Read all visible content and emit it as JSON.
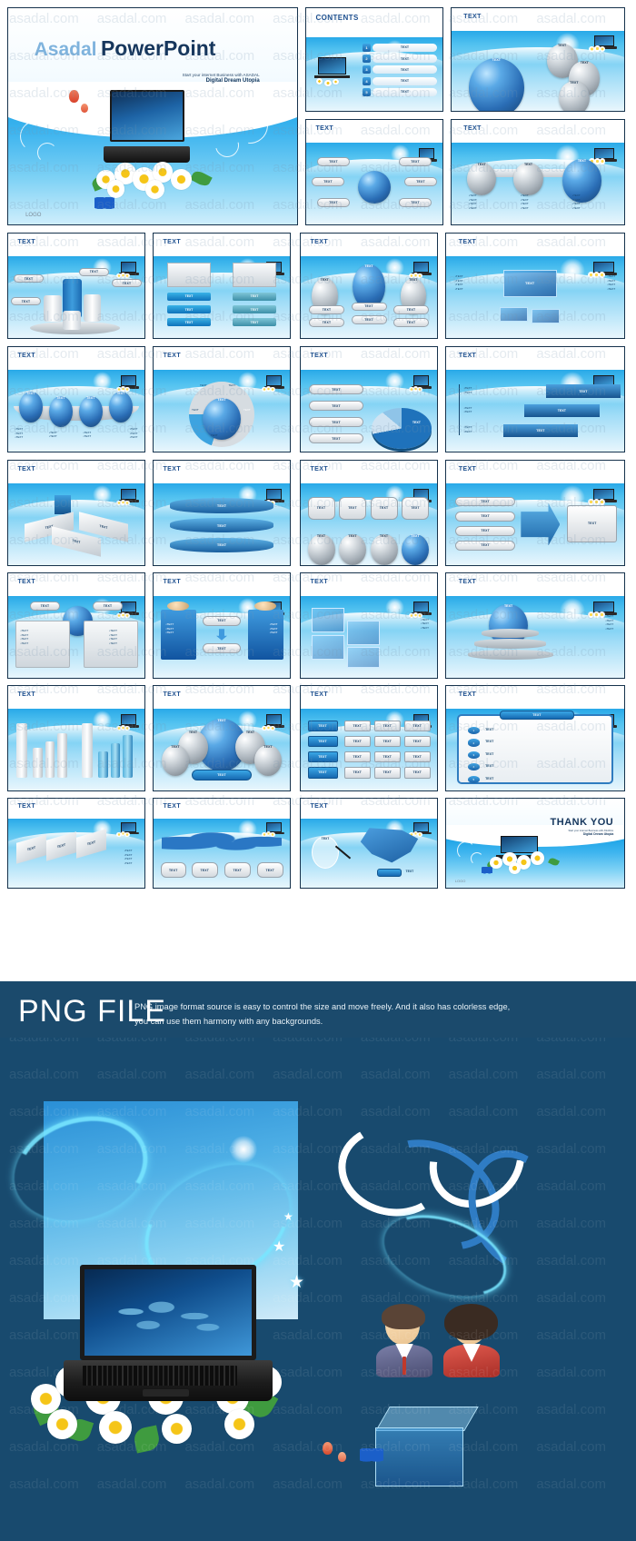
{
  "meta": {
    "watermark_text": "asadal.com"
  },
  "hero": {
    "brand": "Asadal",
    "product": "PowerPoint",
    "tagline": "Start your internet Business with ASADAL",
    "subtitle": "Digital Dream Utopia",
    "logo": "LOGO"
  },
  "contents_slide": {
    "title": "CONTENTS",
    "rows": [
      {
        "num": "1",
        "label": "TEXT"
      },
      {
        "num": "2",
        "label": "TEXT"
      },
      {
        "num": "3",
        "label": "TEXT"
      },
      {
        "num": "4",
        "label": "TEXT"
      },
      {
        "num": "5",
        "label": "TEXT"
      }
    ]
  },
  "thanks_slide": {
    "title": "THANK YOU",
    "tagline": "Start your internet Business with ASADAL",
    "subtitle": "Digital Dream Utopia",
    "logo": "LOGO"
  },
  "generic": {
    "slide_title": "TEXT",
    "chip_label": "TEXT",
    "bullet_label": "TEXT"
  },
  "slides": [
    {
      "id": "s01",
      "kind": "cover",
      "title": "Asadal PowerPoint"
    },
    {
      "id": "s02",
      "kind": "contents",
      "title": "CONTENTS"
    },
    {
      "id": "s03",
      "kind": "radial-spheres",
      "title": "TEXT"
    },
    {
      "id": "s04",
      "kind": "orbit-buttons",
      "title": "TEXT"
    },
    {
      "id": "s05",
      "kind": "process-arrow",
      "title": "TEXT"
    },
    {
      "id": "s06",
      "kind": "cylinder-stage",
      "title": "TEXT"
    },
    {
      "id": "s07",
      "kind": "twin-stacks",
      "title": "TEXT"
    },
    {
      "id": "s08",
      "kind": "egg-columns",
      "title": "TEXT"
    },
    {
      "id": "s09",
      "kind": "cube-diagram",
      "title": "TEXT"
    },
    {
      "id": "s10",
      "kind": "sphere-row",
      "title": "TEXT"
    },
    {
      "id": "s11",
      "kind": "donut-wheel",
      "title": "TEXT"
    },
    {
      "id": "s12",
      "kind": "pie-list",
      "title": "TEXT"
    },
    {
      "id": "s13",
      "kind": "stairs",
      "title": "TEXT"
    },
    {
      "id": "s14",
      "kind": "quadrant",
      "title": "TEXT"
    },
    {
      "id": "s15",
      "kind": "disc-stack",
      "title": "TEXT"
    },
    {
      "id": "s16",
      "kind": "card-grid",
      "title": "TEXT"
    },
    {
      "id": "s17",
      "kind": "arrow-list",
      "title": "TEXT"
    },
    {
      "id": "s18",
      "kind": "compare-panels",
      "title": "TEXT"
    },
    {
      "id": "s19",
      "kind": "people-flow",
      "title": "TEXT"
    },
    {
      "id": "s20",
      "kind": "shelf-boxes",
      "title": "TEXT"
    },
    {
      "id": "s21",
      "kind": "podium",
      "title": "TEXT"
    },
    {
      "id": "s22",
      "kind": "bar-chart",
      "title": "TEXT"
    },
    {
      "id": "s23",
      "kind": "sphere-cluster",
      "title": "TEXT"
    },
    {
      "id": "s24",
      "kind": "matrix-table",
      "title": "TEXT"
    },
    {
      "id": "s25",
      "kind": "notepad-list",
      "title": "TEXT"
    },
    {
      "id": "s26",
      "kind": "ribbon-arrow",
      "title": "TEXT"
    },
    {
      "id": "s27",
      "kind": "world-map",
      "title": "TEXT"
    },
    {
      "id": "s28",
      "kind": "korea-map",
      "title": "TEXT"
    },
    {
      "id": "s29",
      "kind": "thanks",
      "title": "THANK YOU"
    }
  ],
  "png_section": {
    "title": "PNG FILE",
    "description_line1": "PNG image format source is easy to control the size and move freely. And it also has colorless edge,",
    "description_line2": "you can use them harmony with any backgrounds."
  },
  "colors": {
    "dark_navy": "#184a6e",
    "banner": "#1b4a6c",
    "brand_blue": "#16365c",
    "accent_cyan": "#29a9e8",
    "title_blue": "#1d4f8f"
  }
}
